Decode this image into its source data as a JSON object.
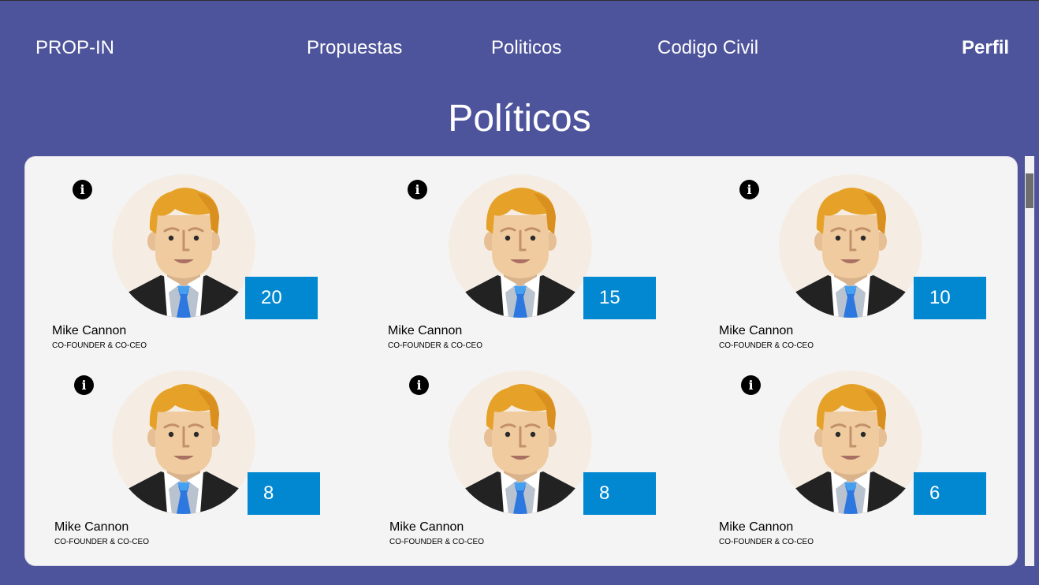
{
  "nav": {
    "brand": "PROP-IN",
    "links": [
      "Propuestas",
      "Politicos",
      "Codigo Civil"
    ],
    "profile": "Perfil"
  },
  "page": {
    "title": "Políticos"
  },
  "colors": {
    "background": "#4e549b",
    "panel": "#f4f4f4",
    "score": "#0288d1"
  },
  "politicians": [
    {
      "name": "Mike Cannon",
      "role": "CO-FOUNDER & CO-CEO",
      "score": "20"
    },
    {
      "name": "Mike Cannon",
      "role": "CO-FOUNDER & CO-CEO",
      "score": "15"
    },
    {
      "name": "Mike Cannon",
      "role": "CO-FOUNDER & CO-CEO",
      "score": "10"
    },
    {
      "name": "Mike Cannon",
      "role": "CO-FOUNDER & CO-CEO",
      "score": "8"
    },
    {
      "name": "Mike Cannon",
      "role": "CO-FOUNDER & CO-CEO",
      "score": "8"
    },
    {
      "name": "Mike Cannon",
      "role": "CO-FOUNDER & CO-CEO",
      "score": "6"
    }
  ],
  "icons": {
    "info": "info-icon",
    "avatar": "man-avatar-illustration"
  }
}
